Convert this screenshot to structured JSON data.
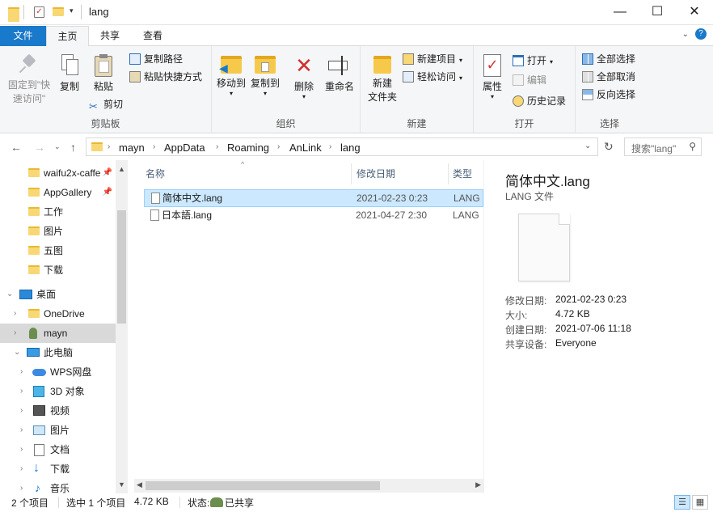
{
  "window": {
    "title": "lang",
    "minimize": "—",
    "maximize": "☐",
    "close": "✕"
  },
  "ribbon_tabs": {
    "file": "文件",
    "home": "主页",
    "share": "共享",
    "view": "查看"
  },
  "ribbon": {
    "clipboard": {
      "label": "剪贴板",
      "pin_line1": "固定到\"快",
      "pin_line2": "速访问\"",
      "copy": "复制",
      "paste": "粘贴",
      "copy_path": "复制路径",
      "paste_shortcut": "粘贴快捷方式",
      "cut": "剪切"
    },
    "organize": {
      "label": "组织",
      "move_to": "移动到",
      "copy_to": "复制到",
      "delete": "删除",
      "rename": "重命名"
    },
    "new": {
      "label": "新建",
      "new_folder_line1": "新建",
      "new_folder_line2": "文件夹",
      "new_item": "新建项目",
      "easy_access": "轻松访问"
    },
    "open": {
      "label": "打开",
      "properties": "属性",
      "open": "打开",
      "edit": "编辑",
      "history": "历史记录"
    },
    "select": {
      "label": "选择",
      "select_all": "全部选择",
      "select_none": "全部取消",
      "invert": "反向选择"
    }
  },
  "address": {
    "crumbs": [
      "mayn",
      "AppData",
      "Roaming",
      "AnLink",
      "lang"
    ],
    "search_placeholder": "搜索\"lang\""
  },
  "nav": {
    "quick": [
      "waifu2x-caffe",
      "AppGallery",
      "工作",
      "图片",
      "五图",
      "下载"
    ],
    "desktop": "桌面",
    "onedrive": "OneDrive",
    "user": "mayn",
    "this_pc": "此电脑",
    "pc_items": [
      "WPS网盘",
      "3D 对象",
      "视频",
      "图片",
      "文档",
      "下载",
      "音乐"
    ]
  },
  "list": {
    "col_name": "名称",
    "col_date": "修改日期",
    "col_type": "类型",
    "rows": [
      {
        "name": "简体中文.lang",
        "date": "2021-02-23 0:23",
        "type": "LANG"
      },
      {
        "name": "日本語.lang",
        "date": "2021-04-27 2:30",
        "type": "LANG"
      }
    ]
  },
  "preview": {
    "name": "简体中文.lang",
    "type": "LANG 文件",
    "props": [
      {
        "k": "修改日期:",
        "v": "2021-02-23 0:23"
      },
      {
        "k": "大小:",
        "v": "4.72 KB"
      },
      {
        "k": "创建日期:",
        "v": "2021-07-06 11:18"
      },
      {
        "k": "共享设备:",
        "v": "Everyone"
      }
    ]
  },
  "status": {
    "count": "2 个项目",
    "selected": "选中 1 个项目",
    "size": "4.72 KB",
    "state_label": "状态:",
    "state_value": "已共享"
  },
  "colors": {
    "accent": "#1979ca",
    "selection": "#cce8ff",
    "folder": "#f6c94b"
  }
}
